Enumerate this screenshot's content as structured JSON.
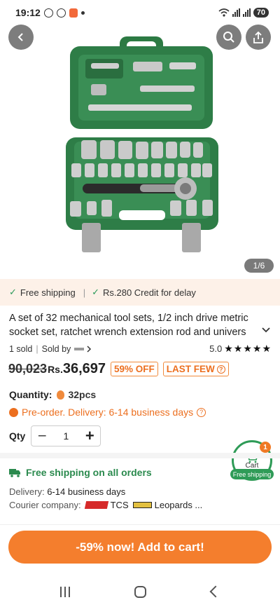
{
  "status_bar": {
    "time": "19:12",
    "battery": "70"
  },
  "gallery": {
    "counter": "1/6"
  },
  "shipping_strip": {
    "free_shipping": "Free shipping",
    "delay_credit": "Rs.280 Credit for delay"
  },
  "product": {
    "title": "A set of 32 mechanical tool sets, 1/2 inch drive metric socket set, ratchet wrench extension rod and univers",
    "sold": "1 sold",
    "sold_by_label": "Sold by",
    "rating": "5.0",
    "stars": "★★★★★",
    "old_price": "90,023",
    "currency": "Rs.",
    "price": "36,697",
    "discount_tag": "59% OFF",
    "stock_tag": "LAST FEW"
  },
  "quantity_info": {
    "label": "Quantity:",
    "value": "32pcs"
  },
  "preorder": {
    "text": "Pre-order. Delivery: 6-14 business days"
  },
  "stepper": {
    "label": "Qty",
    "minus": "−",
    "value": "1",
    "plus": "+"
  },
  "cart_float": {
    "badge": "1",
    "label": "Cart",
    "ribbon": "Free shipping"
  },
  "shipping_section": {
    "title": "Free shipping on all orders",
    "delivery_label": "Delivery:",
    "delivery_value": "6-14 business days",
    "courier_label": "Courier company:",
    "courier_1": "TCS",
    "courier_2": "Leopards ..."
  },
  "cta": {
    "label": "-59% now! Add to cart!"
  },
  "colors": {
    "accent_orange": "#f47e2d",
    "green": "#2f9b57",
    "case_green": "#2e7a45"
  }
}
